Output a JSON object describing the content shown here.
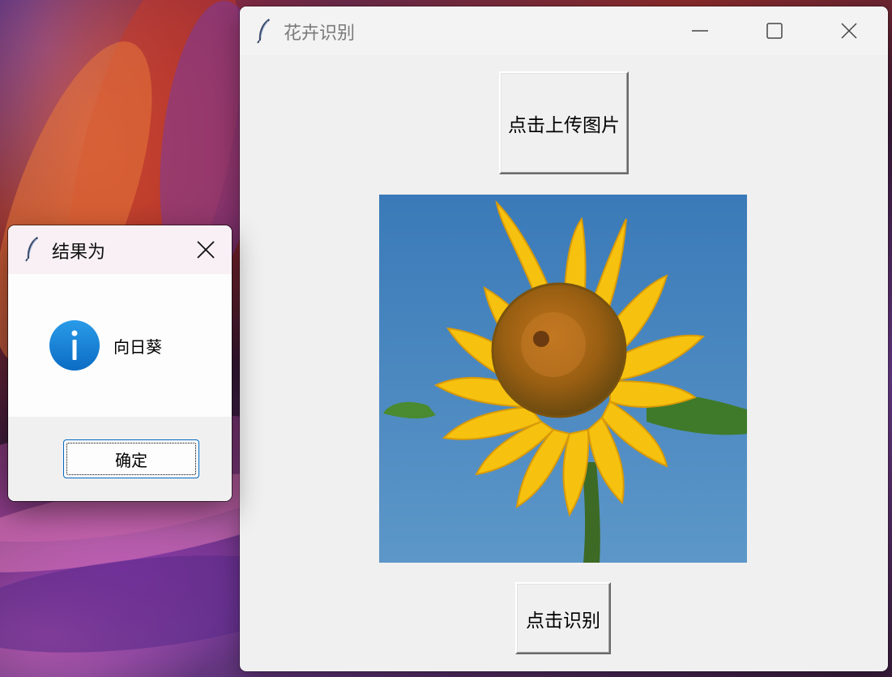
{
  "main_window": {
    "title": "花卉识别",
    "upload_button": "点击上传图片",
    "recognize_button": "点击识别",
    "image_subject": "sunflower-photo"
  },
  "dialog": {
    "title": "结果为",
    "message": "向日葵",
    "ok_button": "确定",
    "icon": "info-icon"
  },
  "colors": {
    "accent": "#0067c0",
    "info_icon": "#1583d8",
    "sky": "#4a8cc8",
    "petal": "#f6c20f"
  }
}
